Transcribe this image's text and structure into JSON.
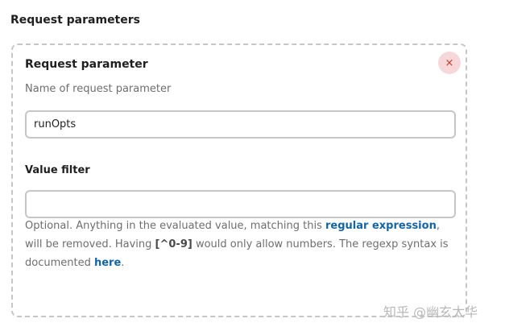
{
  "section": {
    "title": "Request parameters"
  },
  "param": {
    "title": "Request parameter",
    "remove_icon": "×",
    "description": "Name of request parameter",
    "name_value": "runOpts"
  },
  "filter": {
    "label": "Value filter",
    "value": "",
    "help": {
      "part1": "Optional. Anything in the evaluated value, matching this ",
      "link1": "regular expression",
      "part2": ", will be removed. Having ",
      "code": "[^0-9]",
      "part3": " would only allow numbers. The regexp syntax is documented ",
      "link2": "here",
      "part4": "."
    }
  },
  "watermark": "知乎 @幽玄太华",
  "colors": {
    "accent_link": "#1565a6",
    "remove_bg": "#f8d7da",
    "remove_fg": "#c0392b",
    "border": "#c6c6c6"
  }
}
